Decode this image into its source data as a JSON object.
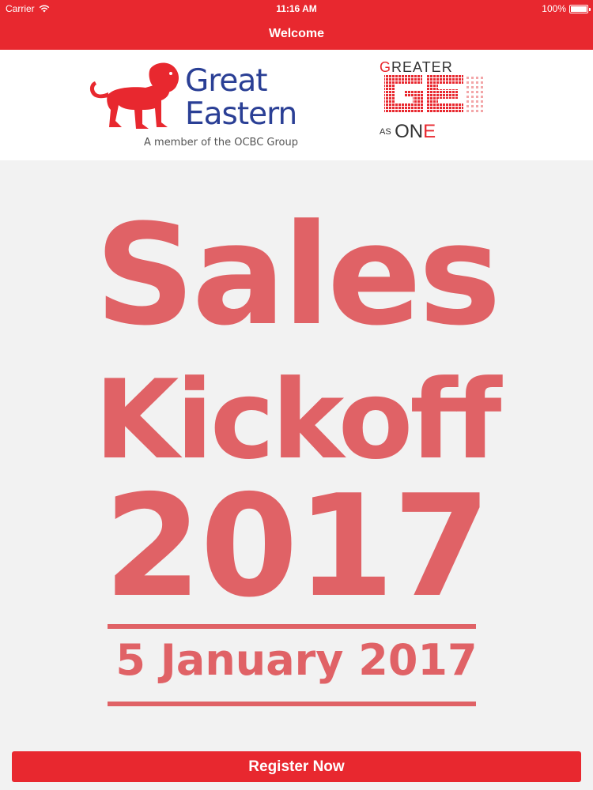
{
  "status_bar": {
    "carrier": "Carrier",
    "time": "11:16 AM",
    "battery": "100%",
    "battery_level": 1.0
  },
  "nav": {
    "title": "Welcome"
  },
  "logos": {
    "great_eastern": {
      "line1": "Great",
      "line2": "Eastern",
      "tagline": "A member of the OCBC Group",
      "brand_color": "#2a3f95",
      "lion_color": "#e8282f"
    },
    "greater_ge": {
      "greater_first": "G",
      "greater_rest": "REATER",
      "mark": "GE",
      "as": "AS",
      "one": "ON",
      "one_last": "E"
    }
  },
  "poster": {
    "line1": "Sales",
    "line2": "Kickoff",
    "line3": "2017",
    "date": "5 January 2017",
    "color": "#e06266"
  },
  "register": {
    "label": "Register Now"
  },
  "colors": {
    "accent": "#e8282f",
    "background": "#f2f2f2"
  }
}
